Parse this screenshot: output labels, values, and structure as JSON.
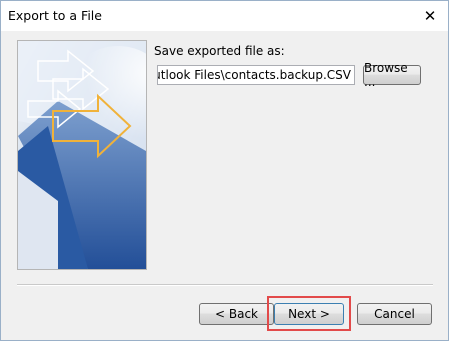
{
  "window": {
    "title": "Export to a File",
    "close_icon": "close-icon"
  },
  "form": {
    "save_label": "Save exported file as:",
    "file_path": "ents\\Outlook Files\\contacts.backup.CSV",
    "browse_label": "Browse ..."
  },
  "buttons": {
    "back_label": "< Back",
    "next_label": "Next >",
    "cancel_label": "Cancel"
  },
  "colors": {
    "highlight": "#e24a4a",
    "image_blue": "#2f5fa5",
    "arrow_orange": "#f0b23a"
  }
}
